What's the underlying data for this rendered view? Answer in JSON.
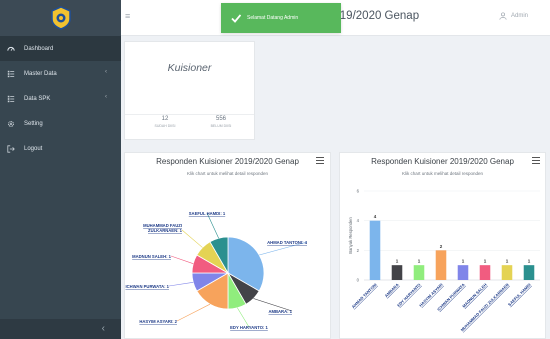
{
  "app": {
    "logo": "university-emblem-icon"
  },
  "sidebar": {
    "items": [
      {
        "label": "Dashboard",
        "icon": "dashboard-icon",
        "active": true,
        "has_submenu": false
      },
      {
        "label": "Master Data",
        "icon": "list-icon",
        "active": false,
        "has_submenu": true
      },
      {
        "label": "Data SPK",
        "icon": "list-icon",
        "active": false,
        "has_submenu": true
      },
      {
        "label": "Setting",
        "icon": "gear-icon",
        "active": false,
        "has_submenu": false
      },
      {
        "label": "Logout",
        "icon": "logout-icon",
        "active": false,
        "has_submenu": false
      }
    ],
    "collapse_glyph": "‹"
  },
  "header": {
    "menu_glyph": "≡",
    "title": "2019/2020 Genap",
    "user": "Admin"
  },
  "toast": {
    "message": "Selamat Datang Admin"
  },
  "kuisioner": {
    "title": "Kuisioner",
    "stats": [
      {
        "value": "12",
        "label": "SUDAH DIISI"
      },
      {
        "value": "556",
        "label": "BELUM DIISI"
      }
    ]
  },
  "pie_card": {
    "title": "Responden Kuisioner 2019/2020 Genap",
    "subtitle": "Klik chart untuk melihat detail responden"
  },
  "bar_card": {
    "title": "Responden Kuisioner 2019/2020 Genap",
    "subtitle": "Klik chart untuk melihat detail responden"
  },
  "chart_data": [
    {
      "type": "pie",
      "title": "Responden Kuisioner 2019/2020 Genap",
      "slices": [
        {
          "label": "AHMAD TANTONI",
          "value": 4,
          "color": "#7cb5ec"
        },
        {
          "label": "AMBARA",
          "value": 1,
          "color": "#434348"
        },
        {
          "label": "EDY HARYANTO",
          "value": 1,
          "color": "#90ed7d"
        },
        {
          "label": "HASYIM ASYARI",
          "value": 2,
          "color": "#f7a35c"
        },
        {
          "label": "ICHWAN PURWATA",
          "value": 1,
          "color": "#8085e9"
        },
        {
          "label": "MADNUN SALEH",
          "value": 1,
          "color": "#f15c80"
        },
        {
          "label": "MUHAMMAD FAUZI ZULKARNAEN",
          "value": 1,
          "color": "#e4d354"
        },
        {
          "label": "SAEFUL HAMDI",
          "value": 1,
          "color": "#2b908f"
        }
      ]
    },
    {
      "type": "bar",
      "title": "Responden Kuisioner 2019/2020 Genap",
      "ylabel": "Banyak Responden",
      "ylim": [
        0,
        6
      ],
      "yticks": [
        0,
        2,
        4,
        6
      ],
      "categories": [
        "AHMAD TANTONI",
        "AMBARA",
        "EDY HARYANTO",
        "HASYIM ASYARI",
        "ICHWAN PURWATA",
        "MADNUN SALEH",
        "MUHAMMAD FAUZI ZULKARNAEN",
        "SAEFUL HAMDI"
      ],
      "values": [
        4,
        1,
        1,
        2,
        1,
        1,
        1,
        1
      ],
      "colors": [
        "#7cb5ec",
        "#434348",
        "#90ed7d",
        "#f7a35c",
        "#8085e9",
        "#f15c80",
        "#e4d354",
        "#2b908f"
      ]
    }
  ]
}
